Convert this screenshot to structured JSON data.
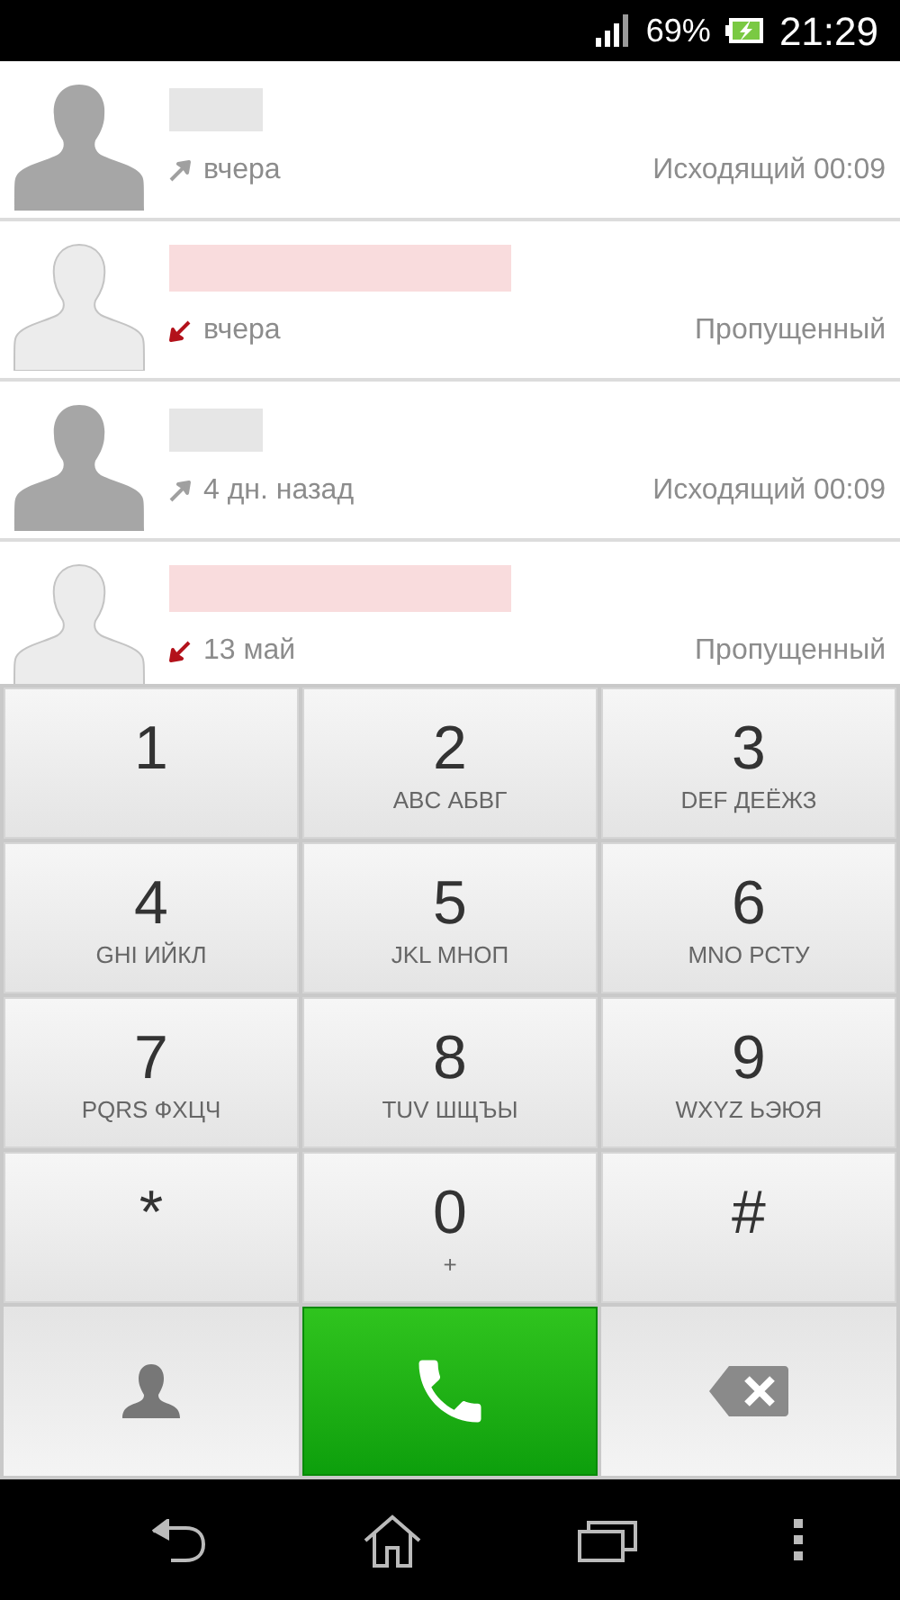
{
  "status_bar": {
    "battery": "69%",
    "time": "21:29"
  },
  "calls": [
    {
      "kind": "outgoing",
      "when": "вчера",
      "status": "Исходящий 00:09"
    },
    {
      "kind": "missed",
      "when": "вчера",
      "status": "Пропущенный"
    },
    {
      "kind": "outgoing",
      "when": "4 дн. назад",
      "status": "Исходящий 00:09"
    },
    {
      "kind": "missed",
      "when": "13 май",
      "status": "Пропущенный"
    }
  ],
  "keys": [
    {
      "digit": "1"
    },
    {
      "digit": "2",
      "letters": "ABC АБВГ"
    },
    {
      "digit": "3",
      "letters": "DEF ДЕЁЖЗ"
    },
    {
      "digit": "4",
      "letters": "GHI ИЙКЛ"
    },
    {
      "digit": "5",
      "letters": "JKL МНОП"
    },
    {
      "digit": "6",
      "letters": "MNO РСТУ"
    },
    {
      "digit": "7",
      "letters": "PQRS ФХЦЧ"
    },
    {
      "digit": "8",
      "letters": "TUV ШЩЪЫ"
    },
    {
      "digit": "9",
      "letters": "WXYZ ЬЭЮЯ"
    },
    {
      "digit": "*"
    },
    {
      "digit": "0",
      "letters": "+"
    },
    {
      "digit": "#"
    }
  ]
}
